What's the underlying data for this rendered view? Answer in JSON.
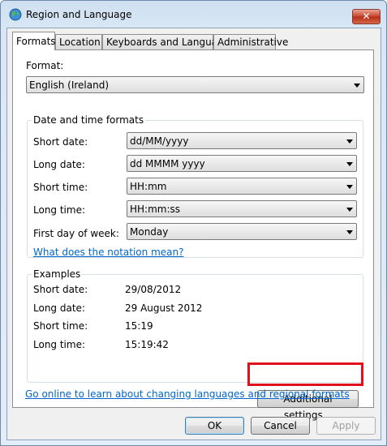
{
  "window": {
    "title": "Region and Language",
    "close_glyph": "✕"
  },
  "tabs": [
    {
      "label": "Formats",
      "active": true
    },
    {
      "label": "Location",
      "active": false
    },
    {
      "label": "Keyboards and Languages",
      "active": false
    },
    {
      "label": "Administrative",
      "active": false
    }
  ],
  "format": {
    "label": "Format:",
    "value": "English (Ireland)"
  },
  "date_time": {
    "title": "Date and time formats",
    "short_date": {
      "label": "Short date:",
      "value": "dd/MM/yyyy"
    },
    "long_date": {
      "label": "Long date:",
      "value": "dd MMMM yyyy"
    },
    "short_time": {
      "label": "Short time:",
      "value": "HH:mm"
    },
    "long_time": {
      "label": "Long time:",
      "value": "HH:mm:ss"
    },
    "first_day": {
      "label": "First day of week:",
      "value": "Monday"
    },
    "notation_link": "What does the notation mean?"
  },
  "examples": {
    "title": "Examples",
    "rows": [
      {
        "label": "Short date:",
        "value": "29/08/2012"
      },
      {
        "label": "Long date:",
        "value": "29 August 2012"
      },
      {
        "label": "Short time:",
        "value": "15:19"
      },
      {
        "label": "Long time:",
        "value": "15:19:42"
      }
    ]
  },
  "additional_settings": "Additional settings...",
  "online_link": "Go online to learn about changing languages and regional formats",
  "buttons": {
    "ok": "OK",
    "cancel": "Cancel",
    "apply": "Apply"
  },
  "colors": {
    "link": "#0066cc",
    "highlight": "#e0101d",
    "close": "#c5442d"
  },
  "icons": [
    "globe-icon",
    "close-icon",
    "dropdown-arrow-icon"
  ]
}
